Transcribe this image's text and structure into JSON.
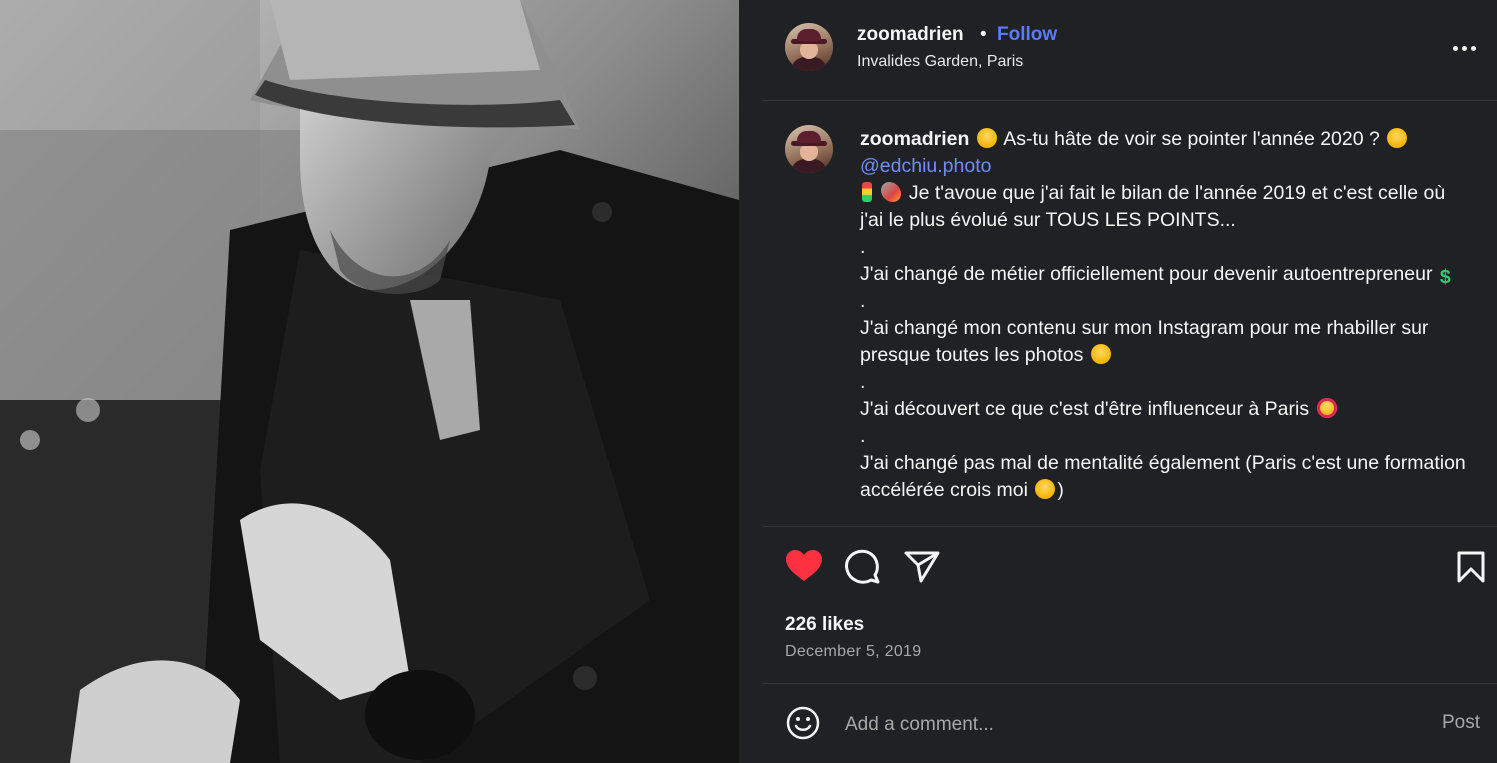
{
  "post": {
    "username": "zoomadrien",
    "separator": "•",
    "follow_label": "Follow",
    "location": "Invalides Garden, Paris"
  },
  "caption": {
    "username": "zoomadrien",
    "intro": "As-tu hâte de voir se pointer l'année 2020 ?",
    "mention": "@edchiu.photo",
    "lines": [
      "Je t'avoue que j'ai fait le bilan de l'année 2019 et c'est celle où j'ai le plus évolué sur TOUS LES POINTS...",
      ".",
      "J'ai changé de métier officiellement pour devenir autoentrepreneur",
      ".",
      "J'ai changé mon contenu sur mon Instagram pour me rhabiller sur presque toutes les photos",
      ".",
      "J'ai découvert ce que c'est d'être influenceur à Paris",
      ".",
      "J'ai changé pas mal de mentalité également (Paris c'est une formation accélérée crois moi",
      ")"
    ],
    "emojis": [
      "woozy-face",
      "thinking-face",
      "traffic-light",
      "rocket",
      "dollar-sign",
      "grinning-sweat",
      "star-struck",
      "yum-face"
    ]
  },
  "actions": {
    "like_icon": "heart-filled-icon",
    "comment_icon": "comment-icon",
    "share_icon": "share-icon",
    "save_icon": "bookmark-icon",
    "like_color": "#ff3040"
  },
  "stats": {
    "likes": "226 likes",
    "date": "December 5, 2019"
  },
  "comment": {
    "placeholder": "Add a comment...",
    "post_label": "Post",
    "emoji_icon": "emoji-icon"
  },
  "colors": {
    "panel_bg": "#202125",
    "link": "#6f8dff",
    "follow": "#5b7bff",
    "muted": "#a8a8a8"
  }
}
